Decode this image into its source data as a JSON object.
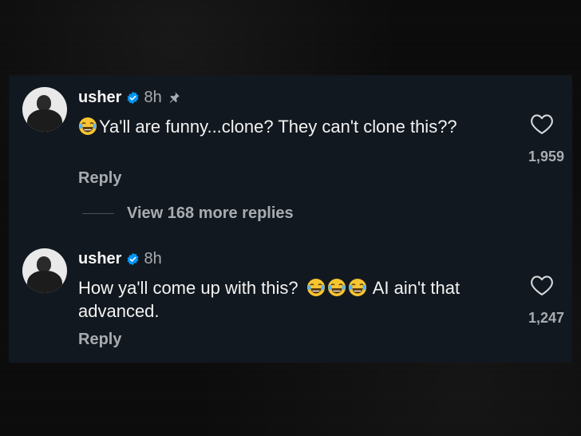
{
  "comments": [
    {
      "username": "usher",
      "time": "8h",
      "pinned": true,
      "text": "Ya'll are funny...clone?  They can't clone this??",
      "reply_label": "Reply",
      "likes": "1,959"
    },
    {
      "username": "usher",
      "time": "8h",
      "pinned": false,
      "text_before": "How ya'll come up with this?",
      "text_after": "AI ain't that advanced.",
      "reply_label": "Reply",
      "likes": "1,247"
    }
  ],
  "view_replies": "View 168 more replies",
  "icons": {
    "verified": "verified-badge-icon",
    "pin": "pin-icon",
    "like": "heart-outline-icon",
    "emoji": "face-with-tears-of-joy-emoji"
  },
  "colors": {
    "card_bg": "#12181f",
    "verified": "#0095f6",
    "muted": "#a8acb1"
  }
}
